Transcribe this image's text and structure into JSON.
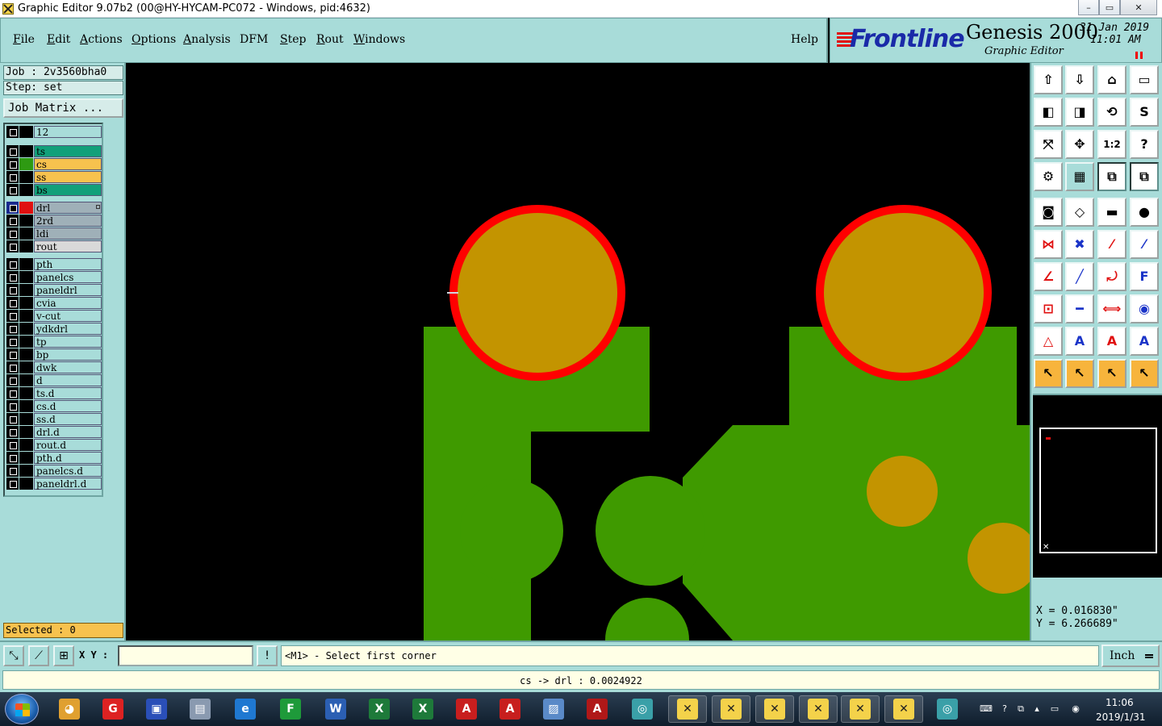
{
  "window": {
    "title": "Graphic Editor 9.07b2 (00@HY-HYCAM-PC072 - Windows, pid:4632)",
    "controls": [
      "–",
      "▭",
      "✕"
    ]
  },
  "menu": [
    {
      "label": "File",
      "underline": "F",
      "rest": "ile"
    },
    {
      "label": "Edit",
      "underline": "E",
      "rest": "dit"
    },
    {
      "label": "Actions",
      "underline": "A",
      "rest": "ctions"
    },
    {
      "label": "Options",
      "underline": "O",
      "rest": "ptions"
    },
    {
      "label": "Analysis",
      "underline": "A",
      "rest": "nalysis"
    },
    {
      "label": "DFM",
      "underline": "",
      "rest": "DFM"
    },
    {
      "label": "Step",
      "underline": "S",
      "rest": "tep"
    },
    {
      "label": "Rout",
      "underline": "R",
      "rest": "out"
    },
    {
      "label": "Windows",
      "underline": "W",
      "rest": "indows"
    },
    {
      "label": "Help",
      "underline": "",
      "rest": "Help"
    }
  ],
  "brand": {
    "logo": "Frontline",
    "product": "Genesis 2000",
    "subtitle": "Graphic Editor",
    "date": "31 Jan 2019",
    "time": "11:01 AM"
  },
  "job": {
    "job_label": "Job : 2v3560bha0",
    "step_label": "Step: set",
    "matrix_button": "Job Matrix ..."
  },
  "layers": [
    {
      "name": "12",
      "color": "#a8dcd9",
      "swatch": "#000000",
      "group": 0
    },
    {
      "name": "ts",
      "color": "#12a07a",
      "swatch": "#000000",
      "group": 1
    },
    {
      "name": "cs",
      "color": "#f7c24e",
      "swatch": "#2e9a12",
      "group": 1
    },
    {
      "name": "ss",
      "color": "#f7c24e",
      "swatch": "#000000",
      "group": 1
    },
    {
      "name": "bs",
      "color": "#12a07a",
      "swatch": "#000000",
      "group": 1
    },
    {
      "name": "drl",
      "color": "#9fb0b8",
      "swatch": "#e01010",
      "group": 2,
      "active": true
    },
    {
      "name": "2rd",
      "color": "#9fb0b8",
      "swatch": "#000000",
      "group": 2
    },
    {
      "name": "ldi",
      "color": "#9fb0b8",
      "swatch": "#000000",
      "group": 2
    },
    {
      "name": "rout",
      "color": "#d9d9d9",
      "swatch": "#000000",
      "group": 2
    },
    {
      "name": "pth",
      "color": "#a8dcd9",
      "swatch": "#000000",
      "group": 3
    },
    {
      "name": "panelcs",
      "color": "#a8dcd9",
      "swatch": "#000000",
      "group": 3
    },
    {
      "name": "paneldrl",
      "color": "#a8dcd9",
      "swatch": "#000000",
      "group": 3
    },
    {
      "name": "cvia",
      "color": "#a8dcd9",
      "swatch": "#000000",
      "group": 3
    },
    {
      "name": "v-cut",
      "color": "#a8dcd9",
      "swatch": "#000000",
      "group": 3
    },
    {
      "name": "ydkdrl",
      "color": "#a8dcd9",
      "swatch": "#000000",
      "group": 3
    },
    {
      "name": "tp",
      "color": "#a8dcd9",
      "swatch": "#000000",
      "group": 3
    },
    {
      "name": "bp",
      "color": "#a8dcd9",
      "swatch": "#000000",
      "group": 3
    },
    {
      "name": "dwk",
      "color": "#a8dcd9",
      "swatch": "#000000",
      "group": 3
    },
    {
      "name": "d",
      "color": "#a8dcd9",
      "swatch": "#000000",
      "group": 3
    },
    {
      "name": "ts.d",
      "color": "#a8dcd9",
      "swatch": "#000000",
      "group": 3
    },
    {
      "name": "cs.d",
      "color": "#a8dcd9",
      "swatch": "#000000",
      "group": 3
    },
    {
      "name": "ss.d",
      "color": "#a8dcd9",
      "swatch": "#000000",
      "group": 3
    },
    {
      "name": "drl.d",
      "color": "#a8dcd9",
      "swatch": "#000000",
      "group": 3
    },
    {
      "name": "rout.d",
      "color": "#a8dcd9",
      "swatch": "#000000",
      "group": 3
    },
    {
      "name": "pth.d",
      "color": "#a8dcd9",
      "swatch": "#000000",
      "group": 3
    },
    {
      "name": "panelcs.d",
      "color": "#a8dcd9",
      "swatch": "#000000",
      "group": 3
    },
    {
      "name": "paneldrl.d",
      "color": "#a8dcd9",
      "swatch": "#000000",
      "group": 3
    }
  ],
  "selected": "Selected : 0",
  "canvas_colors": {
    "copper": "#3f9a00",
    "pad": "#c39400",
    "drill": "#ff0000",
    "background": "#000000"
  },
  "tools": [
    {
      "name": "step-up-icon",
      "glyph": "⇧",
      "style": "white"
    },
    {
      "name": "step-down-icon",
      "glyph": "⇩",
      "style": "white"
    },
    {
      "name": "home-icon",
      "glyph": "⌂",
      "style": "white"
    },
    {
      "name": "window-icon",
      "glyph": "▭",
      "style": "white"
    },
    {
      "name": "pan-left-icon",
      "glyph": "◧",
      "style": "white"
    },
    {
      "name": "pan-right-icon",
      "glyph": "◨",
      "style": "white"
    },
    {
      "name": "redraw-icon",
      "glyph": "⟲",
      "style": "white"
    },
    {
      "name": "snap-icon",
      "glyph": "S",
      "style": "white"
    },
    {
      "name": "zoom-fit-icon",
      "glyph": "⤧",
      "style": "white"
    },
    {
      "name": "zoom-center-icon",
      "glyph": "✥",
      "style": "white"
    },
    {
      "name": "scale-icon",
      "glyph": "1:2",
      "style": "white"
    },
    {
      "name": "help-icon",
      "glyph": "?",
      "style": "white"
    },
    {
      "name": "measure-tool-icon",
      "glyph": "⚙",
      "style": "white"
    },
    {
      "name": "grid-icon",
      "glyph": "▦",
      "style": "default"
    },
    {
      "name": "layers-icon",
      "glyph": "⧉",
      "style": "white",
      "pressed": true
    },
    {
      "name": "layers-alt-icon",
      "glyph": "⧉",
      "style": "white",
      "pressed": true
    },
    {
      "name": "fill-icon",
      "glyph": "◙",
      "style": "white"
    },
    {
      "name": "outline-icon",
      "glyph": "◇",
      "style": "white"
    },
    {
      "name": "ruler-icon",
      "glyph": "▬",
      "style": "white"
    },
    {
      "name": "pad-icon",
      "glyph": "●",
      "style": "white"
    },
    {
      "name": "netlist-icon",
      "glyph": "⋈",
      "style": "white"
    },
    {
      "name": "cross-icon",
      "glyph": "✖",
      "style": "white"
    },
    {
      "name": "line-icon",
      "glyph": "⁄",
      "style": "white"
    },
    {
      "name": "line-alt-icon",
      "glyph": "⁄",
      "style": "white"
    },
    {
      "name": "angle-icon",
      "glyph": "∠",
      "style": "white"
    },
    {
      "name": "diagonal-icon",
      "glyph": "╱",
      "style": "white"
    },
    {
      "name": "arc-icon",
      "glyph": "⤾",
      "style": "white"
    },
    {
      "name": "text-icon",
      "glyph": "F",
      "style": "white"
    },
    {
      "name": "connect-icon",
      "glyph": "⊡",
      "style": "white"
    },
    {
      "name": "horizontal-icon",
      "glyph": "━",
      "style": "white"
    },
    {
      "name": "size-icon",
      "glyph": "⟺",
      "style": "white"
    },
    {
      "name": "shapes-icon",
      "glyph": "◉",
      "style": "white"
    },
    {
      "name": "drc-icon",
      "glyph": "△",
      "style": "white"
    },
    {
      "name": "drc-a-icon",
      "glyph": "A",
      "style": "white"
    },
    {
      "name": "drc-b-icon",
      "glyph": "A",
      "style": "white"
    },
    {
      "name": "drc-c-icon",
      "glyph": "A",
      "style": "white"
    },
    {
      "name": "select-icon",
      "glyph": "↖",
      "style": "orange"
    },
    {
      "name": "select-box-icon",
      "glyph": "↖",
      "style": "orange"
    },
    {
      "name": "select-round-icon",
      "glyph": "↖",
      "style": "orange"
    },
    {
      "name": "select-net-icon",
      "glyph": "↖",
      "style": "orange"
    }
  ],
  "coords": {
    "x": "X = 0.016830\"",
    "y": "Y = 6.266689\""
  },
  "input": {
    "xy_label": "X Y :",
    "xy_value": "",
    "prompt": "<M1> - Select first corner",
    "units": "Inch"
  },
  "status": "cs -> drl : 0.0024922",
  "taskbar": {
    "time": "11:06",
    "date": "2019/1/31",
    "apps": [
      {
        "name": "shell-app-icon",
        "glyph": "◕",
        "bg": "#e0a030"
      },
      {
        "name": "redapp-icon",
        "glyph": "G",
        "bg": "#d22"
      },
      {
        "name": "save-app-icon",
        "glyph": "▣",
        "bg": "#2a4fb8"
      },
      {
        "name": "scanner-app-icon",
        "glyph": "▤",
        "bg": "#8a9ab0"
      },
      {
        "name": "ie-app-icon",
        "glyph": "e",
        "bg": "#1f78d1"
      },
      {
        "name": "frontline-app-icon",
        "glyph": "F",
        "bg": "#1e9a3a"
      },
      {
        "name": "word-app-icon",
        "glyph": "W",
        "bg": "#2b5fb3"
      },
      {
        "name": "excel-app-icon",
        "glyph": "X",
        "bg": "#1e7a3a"
      },
      {
        "name": "excel2-app-icon",
        "glyph": "X",
        "bg": "#1e7a3a"
      },
      {
        "name": "pdf-app-icon",
        "glyph": "A",
        "bg": "#c81e1e"
      },
      {
        "name": "pdf2-app-icon",
        "glyph": "A",
        "bg": "#c81e1e"
      },
      {
        "name": "photo-app-icon",
        "glyph": "▨",
        "bg": "#5a8ac8"
      },
      {
        "name": "cad-app-icon",
        "glyph": "A",
        "bg": "#b01818"
      },
      {
        "name": "camera-app-icon",
        "glyph": "◎",
        "bg": "#3aa0a8"
      },
      {
        "name": "genesis1-app-icon",
        "glyph": "✕",
        "bg": "#f4d24a",
        "active": true
      },
      {
        "name": "genesis2-app-icon",
        "glyph": "✕",
        "bg": "#f4d24a",
        "active": true
      },
      {
        "name": "genesis3-app-icon",
        "glyph": "✕",
        "bg": "#f4d24a",
        "active": true
      },
      {
        "name": "genesis4-app-icon",
        "glyph": "✕",
        "bg": "#f4d24a",
        "active": true
      },
      {
        "name": "genesis5-app-icon",
        "glyph": "✕",
        "bg": "#f4d24a",
        "active": true
      },
      {
        "name": "genesis6-app-icon",
        "glyph": "✕",
        "bg": "#f4d24a",
        "active": true
      },
      {
        "name": "viewer-app-icon",
        "glyph": "◎",
        "bg": "#3aa0a8"
      }
    ]
  }
}
